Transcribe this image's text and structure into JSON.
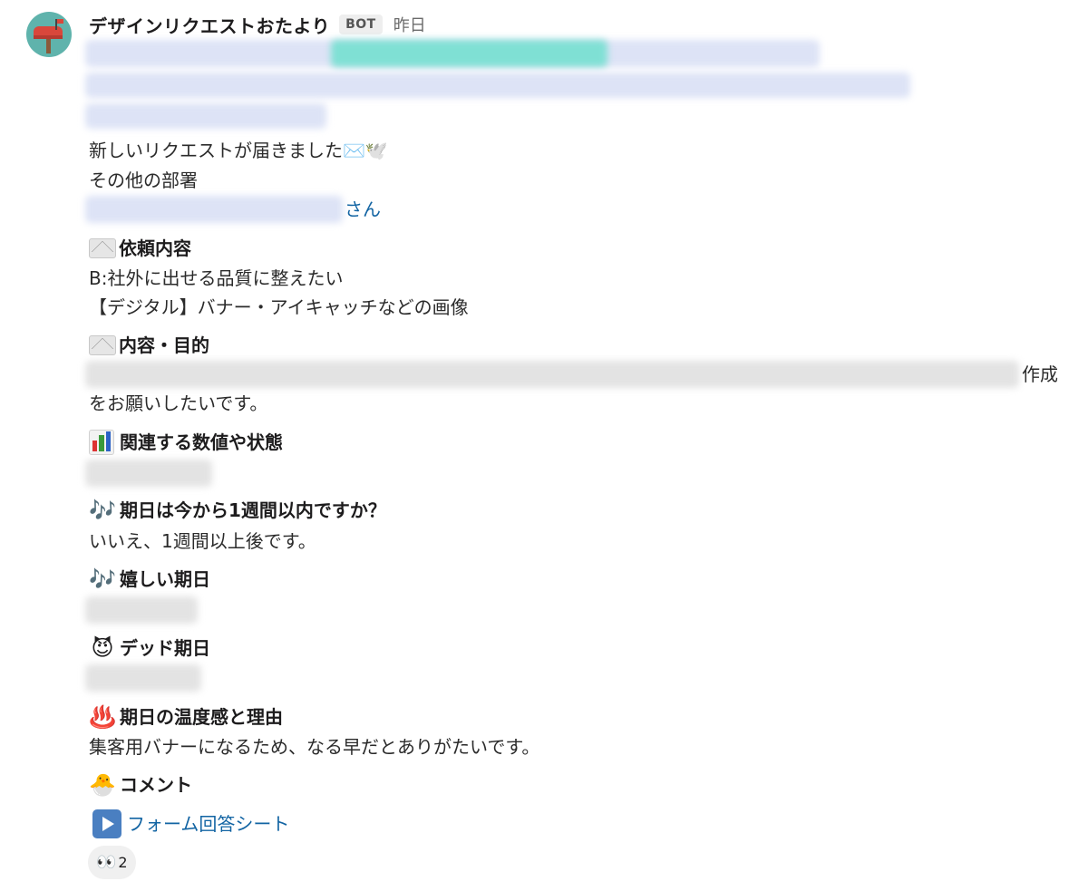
{
  "message": {
    "sender": "デザインリクエストおたより",
    "badge": "BOT",
    "timestamp": "昨日"
  },
  "body": {
    "intro": "新しいリクエストが届きました✉️🕊️",
    "department": "その他の部署",
    "requester_suffix": "さん",
    "request_heading": "依頼内容",
    "request_line1": "B:社外に出せる品質に整えたい",
    "request_line2": "【デジタル】バナー・アイキャッチなどの画像",
    "purpose_heading": "内容・目的",
    "purpose_suffix": "作成",
    "purpose_line2": "をお願いしたいです。",
    "metrics_heading": "関連する数値や状態",
    "deadline_q_heading": "期日は今から1週間以内ですか？",
    "deadline_q_answer": "いいえ、1週間以上後です。",
    "preferred_date_heading": "嬉しい期日",
    "dead_date_heading": "デッド期日",
    "urgency_heading": "期日の温度感と理由",
    "urgency_text": "集客用バナーになるため、なる早だとありがたいです。",
    "comment_heading": "コメント",
    "form_link": "フォーム回答シート"
  },
  "icons": {
    "music": "🎶",
    "devil": "😈",
    "hot_springs": "♨️",
    "chick": "🐣",
    "eyes": "👀"
  },
  "reaction": {
    "emoji": "👀",
    "count": "2"
  },
  "colors": {
    "link": "#1264a3",
    "avatar_bg": "#5fb3ac",
    "highlight": "#7fe0d4"
  }
}
